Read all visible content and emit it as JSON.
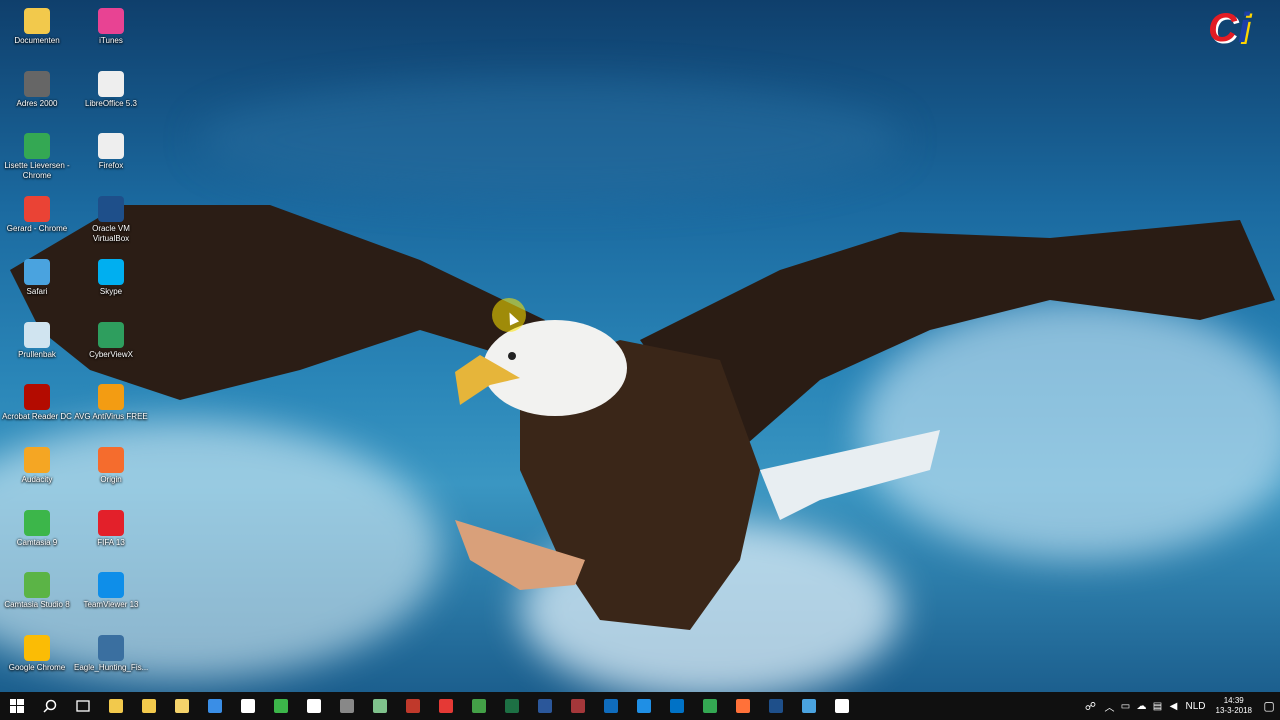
{
  "desktop": {
    "icons": [
      {
        "label": "Documenten",
        "color": "#f2c94c"
      },
      {
        "label": "iTunes",
        "color": "#e84393"
      },
      {
        "label": "Adres 2000",
        "color": "#666666"
      },
      {
        "label": "LibreOffice 5.3",
        "color": "#eeeeee"
      },
      {
        "label": "Lisette Lieversen - Chrome",
        "color": "#34a853"
      },
      {
        "label": "Firefox",
        "color": "#eeeeee"
      },
      {
        "label": "Gerard - Chrome",
        "color": "#ea4335"
      },
      {
        "label": "Oracle VM VirtualBox",
        "color": "#1e4f8a"
      },
      {
        "label": "Safari",
        "color": "#4aa3df"
      },
      {
        "label": "Skype",
        "color": "#00aff0"
      },
      {
        "label": "Prullenbak",
        "color": "#d0e4f0"
      },
      {
        "label": "CyberViewX",
        "color": "#2e9e5e"
      },
      {
        "label": "Acrobat Reader DC",
        "color": "#b30b00"
      },
      {
        "label": "AVG AntiVirus FREE",
        "color": "#f39c12"
      },
      {
        "label": "Audacity",
        "color": "#f5a623"
      },
      {
        "label": "Origin",
        "color": "#f56c2d"
      },
      {
        "label": "Camtasia 9",
        "color": "#3cb64a"
      },
      {
        "label": "FIFA 13",
        "color": "#e3202a"
      },
      {
        "label": "Camtasia Studio 8",
        "color": "#5bb446"
      },
      {
        "label": "TeamViewer 13",
        "color": "#0e8ee9"
      },
      {
        "label": "Google Chrome",
        "color": "#fbbc05"
      },
      {
        "label": "Eagle_Hunting_Fis...",
        "color": "#3a6fa0"
      }
    ]
  },
  "branding": {
    "c": "C",
    "i": "i"
  },
  "taskbar": {
    "start_icon": "windows-start-icon",
    "search_icon": "search-icon",
    "taskview_icon": "task-view-icon",
    "apps": [
      {
        "name": "file-explorer",
        "color": "#f2c94c"
      },
      {
        "name": "file-explorer-2",
        "color": "#f2c94c"
      },
      {
        "name": "folder",
        "color": "#f5d36b"
      },
      {
        "name": "store",
        "color": "#3a8ee6"
      },
      {
        "name": "mail",
        "color": "#ffffff"
      },
      {
        "name": "camtasia-9",
        "color": "#3cb64a"
      },
      {
        "name": "camtasia-studio",
        "color": "#ffffff"
      },
      {
        "name": "calculator",
        "color": "#888888"
      },
      {
        "name": "app-green",
        "color": "#7fc28c"
      },
      {
        "name": "app-red-swirl",
        "color": "#c0392b"
      },
      {
        "name": "recorder-red",
        "color": "#e53935"
      },
      {
        "name": "camtasia-green",
        "color": "#43a047"
      },
      {
        "name": "excel",
        "color": "#1d7044"
      },
      {
        "name": "word",
        "color": "#2b579a"
      },
      {
        "name": "access",
        "color": "#a4373a"
      },
      {
        "name": "outlook-mail",
        "color": "#0f6cbd"
      },
      {
        "name": "edge",
        "color": "#1f8fe5"
      },
      {
        "name": "outlook",
        "color": "#0072c6"
      },
      {
        "name": "chrome",
        "color": "#34a853"
      },
      {
        "name": "firefox",
        "color": "#ff7139"
      },
      {
        "name": "virtualbox",
        "color": "#1e4f8a"
      },
      {
        "name": "safari",
        "color": "#4aa3df"
      },
      {
        "name": "camtasia-recorder",
        "color": "#ffffff"
      }
    ],
    "tray": {
      "language": "NLD",
      "time": "14:39",
      "date": "13-3-2018"
    }
  }
}
